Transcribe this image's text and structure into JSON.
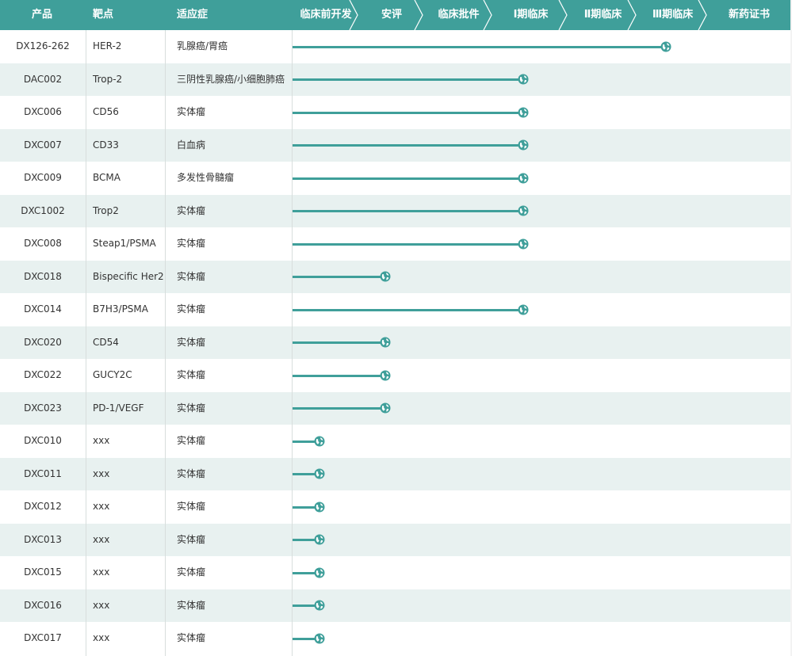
{
  "header": {
    "product": "产品",
    "target": "靶点",
    "indication": "适应症"
  },
  "stages": [
    "临床前开发",
    "安评",
    "临床批件",
    "Ⅰ期临床",
    "Ⅱ期临床",
    "Ⅲ期临床",
    "新药证书"
  ],
  "colors": {
    "accent": "#3f9f9a",
    "header_text": "#ffffff",
    "row_alt": "#e8f1f0",
    "text": "#333333"
  },
  "progress_marker_icon": "globe-icon",
  "chart_data": {
    "type": "bar",
    "orientation": "horizontal",
    "categories": [
      "临床前开发",
      "安评",
      "临床批件",
      "Ⅰ期临床",
      "Ⅱ期临床",
      "Ⅲ期临床",
      "新药证书"
    ],
    "rows": [
      {
        "product": "DX126-262",
        "target": "HER-2",
        "indication": "乳腺癌/胃癌",
        "stage_progress": 5.4
      },
      {
        "product": "DAC002",
        "target": "Trop-2",
        "indication": "三阴性乳腺癌/小细胞肺癌",
        "stage_progress": 3.4
      },
      {
        "product": "DXC006",
        "target": "CD56",
        "indication": "实体瘤",
        "stage_progress": 3.4
      },
      {
        "product": "DXC007",
        "target": "CD33",
        "indication": "白血病",
        "stage_progress": 3.4
      },
      {
        "product": "DXC009",
        "target": "BCMA",
        "indication": "多发性骨髓瘤",
        "stage_progress": 3.4
      },
      {
        "product": "DXC1002",
        "target": "Trop2",
        "indication": "实体瘤",
        "stage_progress": 3.4
      },
      {
        "product": "DXC008",
        "target": "Steap1/PSMA",
        "indication": "实体瘤",
        "stage_progress": 3.4
      },
      {
        "product": "DXC018",
        "target": "Bispecific Her2",
        "indication": "实体瘤",
        "stage_progress": 1.4
      },
      {
        "product": "DXC014",
        "target": "B7H3/PSMA",
        "indication": "实体瘤",
        "stage_progress": 3.4
      },
      {
        "product": "DXC020",
        "target": "CD54",
        "indication": "实体瘤",
        "stage_progress": 1.4
      },
      {
        "product": "DXC022",
        "target": "GUCY2C",
        "indication": "实体瘤",
        "stage_progress": 1.4
      },
      {
        "product": "DXC023",
        "target": "PD-1/VEGF",
        "indication": "实体瘤",
        "stage_progress": 1.4
      },
      {
        "product": "DXC010",
        "target": "xxx",
        "indication": "实体瘤",
        "stage_progress": 0.4
      },
      {
        "product": "DXC011",
        "target": "xxx",
        "indication": "实体瘤",
        "stage_progress": 0.4
      },
      {
        "product": "DXC012",
        "target": "xxx",
        "indication": "实体瘤",
        "stage_progress": 0.4
      },
      {
        "product": "DXC013",
        "target": "xxx",
        "indication": "实体瘤",
        "stage_progress": 0.4
      },
      {
        "product": "DXC015",
        "target": "xxx",
        "indication": "实体瘤",
        "stage_progress": 0.4
      },
      {
        "product": "DXC016",
        "target": "xxx",
        "indication": "实体瘤",
        "stage_progress": 0.4
      },
      {
        "product": "DXC017",
        "target": "xxx",
        "indication": "实体瘤",
        "stage_progress": 0.4
      }
    ],
    "xlim": [
      0,
      7
    ],
    "title": "",
    "xlabel": "",
    "ylabel": "",
    "grid": false,
    "legend": "none"
  }
}
